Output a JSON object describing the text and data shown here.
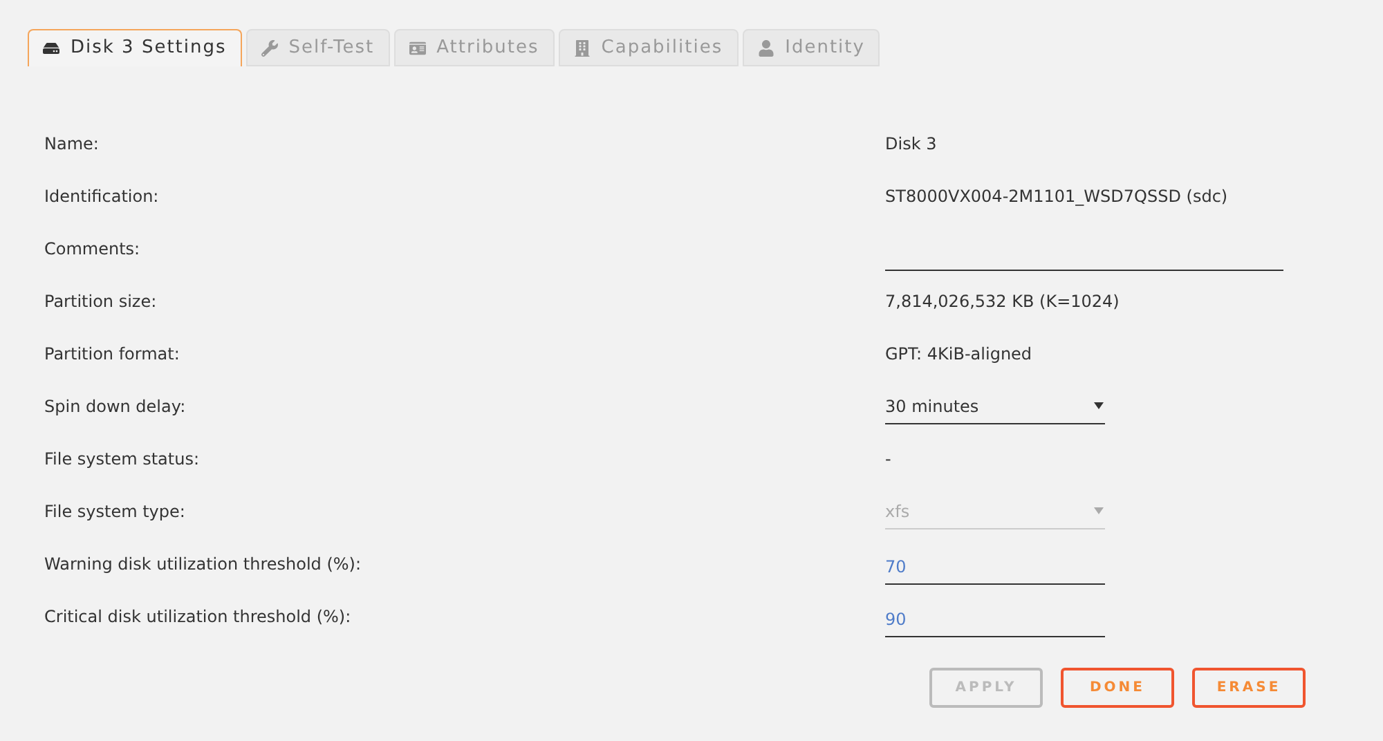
{
  "tabs": [
    {
      "label": "Disk 3 Settings",
      "kind": "disk",
      "selected": true
    },
    {
      "label": "Self-Test",
      "kind": "tool",
      "selected": false
    },
    {
      "label": "Attributes",
      "kind": "card",
      "selected": false
    },
    {
      "label": "Capabilities",
      "kind": "building",
      "selected": false
    },
    {
      "label": "Identity",
      "kind": "person",
      "selected": false
    }
  ],
  "settings": [
    {
      "label": "Name:",
      "kind": "text",
      "value": "Disk 3"
    },
    {
      "label": "Identification:",
      "kind": "text",
      "value": "ST8000VX004-2M1101_WSD7QSSD (sdc)"
    },
    {
      "label": "Comments:",
      "kind": "text_field"
    },
    {
      "label": "Partition size:",
      "kind": "text",
      "value": "7,814,026,532 KB (K=1024)"
    },
    {
      "label": "Partition format:",
      "kind": "text",
      "value": "GPT: 4KiB-aligned"
    },
    {
      "label": "Spin down delay:",
      "kind": "select",
      "value": "30 minutes",
      "disabled": false
    },
    {
      "label": "File system status:",
      "kind": "text",
      "value": "-"
    },
    {
      "label": "File system type:",
      "kind": "select",
      "value": "xfs",
      "disabled": true
    },
    {
      "label": "Warning disk utilization threshold (%):",
      "kind": "number",
      "value": "70"
    },
    {
      "label": "Critical disk utilization threshold (%):",
      "kind": "number",
      "value": "90"
    }
  ],
  "buttons": [
    {
      "label": "APPLY",
      "disabled": true
    },
    {
      "label": "DONE",
      "disabled": false
    },
    {
      "label": "ERASE",
      "disabled": false
    }
  ]
}
